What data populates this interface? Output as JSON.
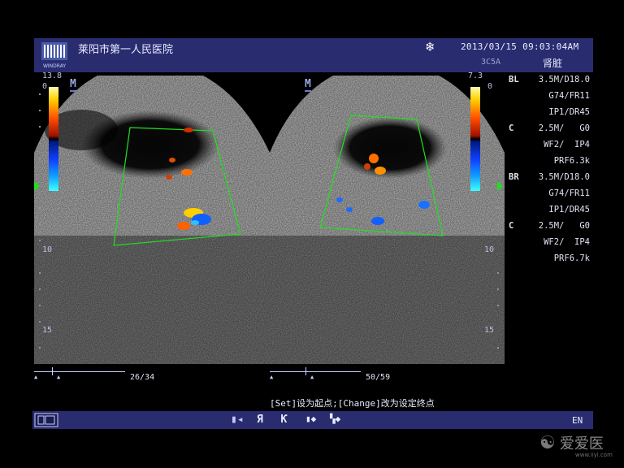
{
  "header": {
    "hospital": "莱阳市第一人民医院",
    "logo_text": "WINDRAY",
    "freeze_icon": "snowflake-icon",
    "datetime": "2013/03/15  09:03:04AM",
    "probe": "3C5A",
    "organ": "肾脏"
  },
  "left_image": {
    "color_max": "13.8",
    "color_min": "0",
    "depth_marks": [
      "10",
      "15"
    ],
    "frame": "26/34"
  },
  "right_image": {
    "color_max": "7.3",
    "color_min": "0",
    "depth_marks": [
      "10",
      "15"
    ],
    "frame": "50/59"
  },
  "params": {
    "bl": {
      "label": "BL",
      "freq": "3.5M",
      "d": "D18.0",
      "g": "G74",
      "fr": "FR11",
      "ip": "IP1",
      "dr": "DR45"
    },
    "c1": {
      "label": "C",
      "freq": "2.5M",
      "g": "G0",
      "wf": "WF2",
      "ip": "IP4",
      "prf": "PRF6.3k"
    },
    "br": {
      "label": "BR",
      "freq": "3.5M",
      "d": "D18.0",
      "g": "G74",
      "fr": "FR11",
      "ip": "IP1",
      "dr": "DR45"
    },
    "c2": {
      "label": "C",
      "freq": "2.5M",
      "g": "G0",
      "wf": "WF2",
      "ip": "IP4",
      "prf": "PRF6.7k"
    }
  },
  "hint": "[Set]设为起点;[Change]改为设定终点",
  "footer": {
    "icons": [
      "layout-icon",
      "split-icon",
      "flip-r-icon",
      "flip-k-icon",
      "up-down-icon",
      "grid-icon"
    ],
    "language": "EN"
  },
  "watermark": {
    "text": "爱爱医",
    "url": "www.iiyi.com"
  },
  "accent_colors": {
    "header_bg": "#2a2c70",
    "roi_box": "#20e020",
    "marker": "#6a7ac8"
  }
}
